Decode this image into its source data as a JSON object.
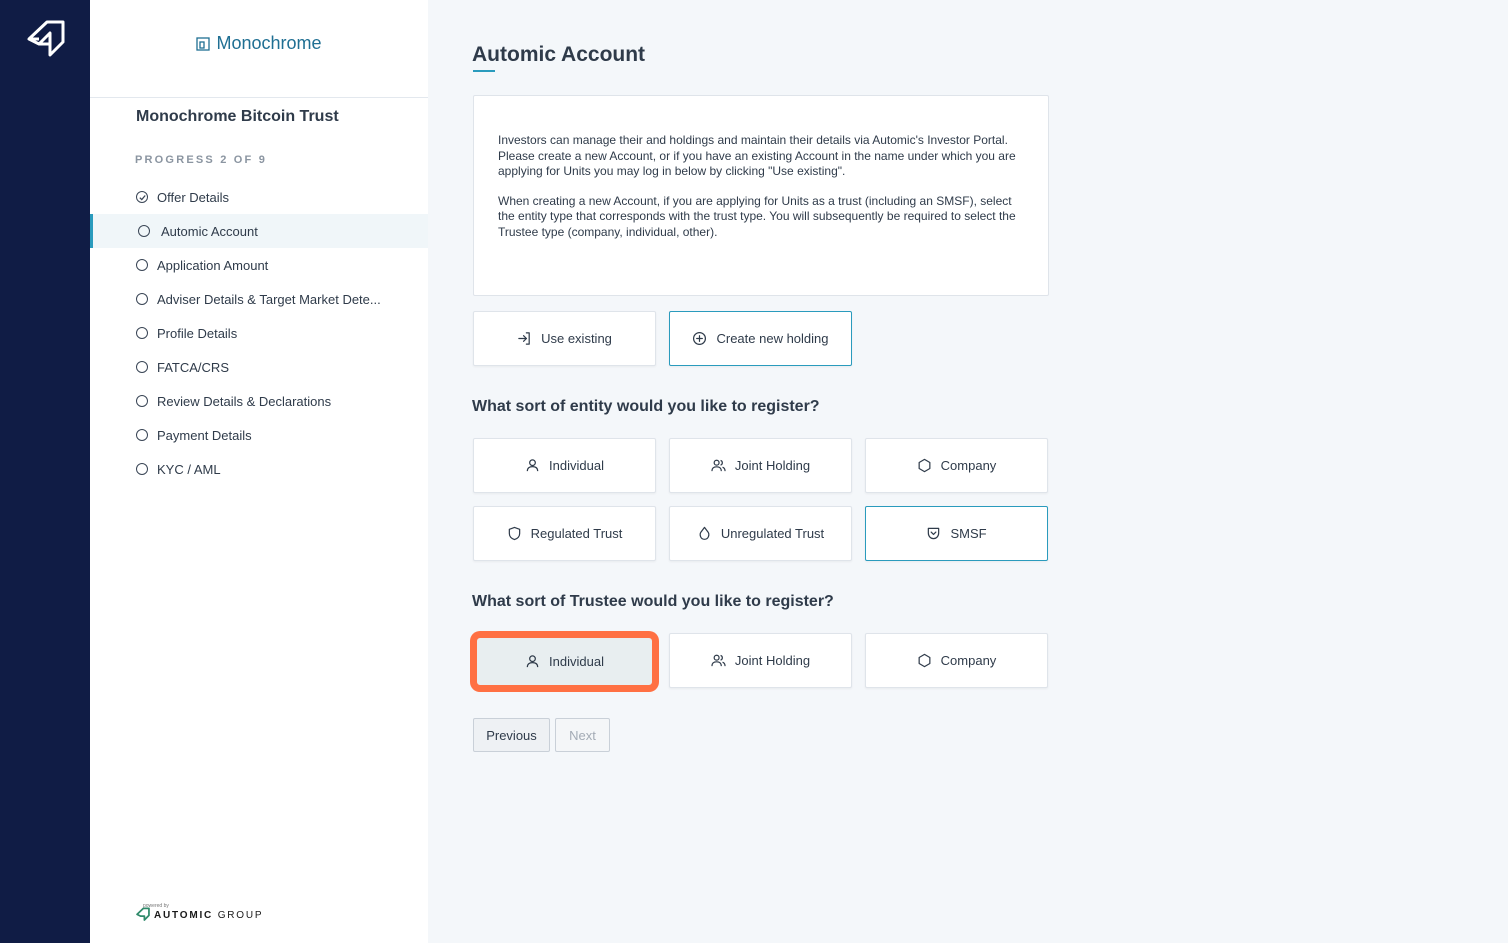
{
  "brand": {
    "name": "Monochrome"
  },
  "sidebar": {
    "offer_title": "Monochrome Bitcoin Trust",
    "progress": "PROGRESS 2 OF 9",
    "steps": [
      {
        "label": "Offer Details",
        "state": "done"
      },
      {
        "label": "Automic Account",
        "state": "active"
      },
      {
        "label": "Application Amount",
        "state": "pending"
      },
      {
        "label": "Adviser Details & Target Market Dete...",
        "state": "pending"
      },
      {
        "label": "Profile Details",
        "state": "pending"
      },
      {
        "label": "FATCA/CRS",
        "state": "pending"
      },
      {
        "label": "Review Details & Declarations",
        "state": "pending"
      },
      {
        "label": "Payment Details",
        "state": "pending"
      },
      {
        "label": "KYC / AML",
        "state": "pending"
      }
    ],
    "powered_by": {
      "small": "powered by",
      "name_bold": "AUTOMIC",
      "name_light": "GROUP"
    }
  },
  "main": {
    "title": "Automic Account",
    "info_paragraphs": [
      "Investors can manage their and holdings and maintain their details via Automic's Investor Portal. Please create a new Account, or if you have an existing Account in the name under which you are applying for Units you may log in below by clicking \"Use existing\".",
      "When creating a new Account, if you are applying for Units as a trust (including an SMSF), select the entity type that corresponds with the trust type. You will subsequently be required to select the Trustee type (company, individual, other)."
    ],
    "account_options": {
      "use_existing": "Use existing",
      "create_new": "Create new holding"
    },
    "entity_question": "What sort of entity would you like to register?",
    "entity_options": {
      "individual": "Individual",
      "joint": "Joint Holding",
      "company": "Company",
      "regulated_trust": "Regulated Trust",
      "unregulated_trust": "Unregulated Trust",
      "smsf": "SMSF"
    },
    "trustee_question": "What sort of Trustee would you like to register?",
    "trustee_options": {
      "individual": "Individual",
      "joint": "Joint Holding",
      "company": "Company"
    },
    "buttons": {
      "previous": "Previous",
      "next": "Next"
    }
  },
  "colors": {
    "rail": "#101c45",
    "accent": "#2a9bbd",
    "highlight": "#ff7043",
    "brand": "#1f6f93"
  }
}
